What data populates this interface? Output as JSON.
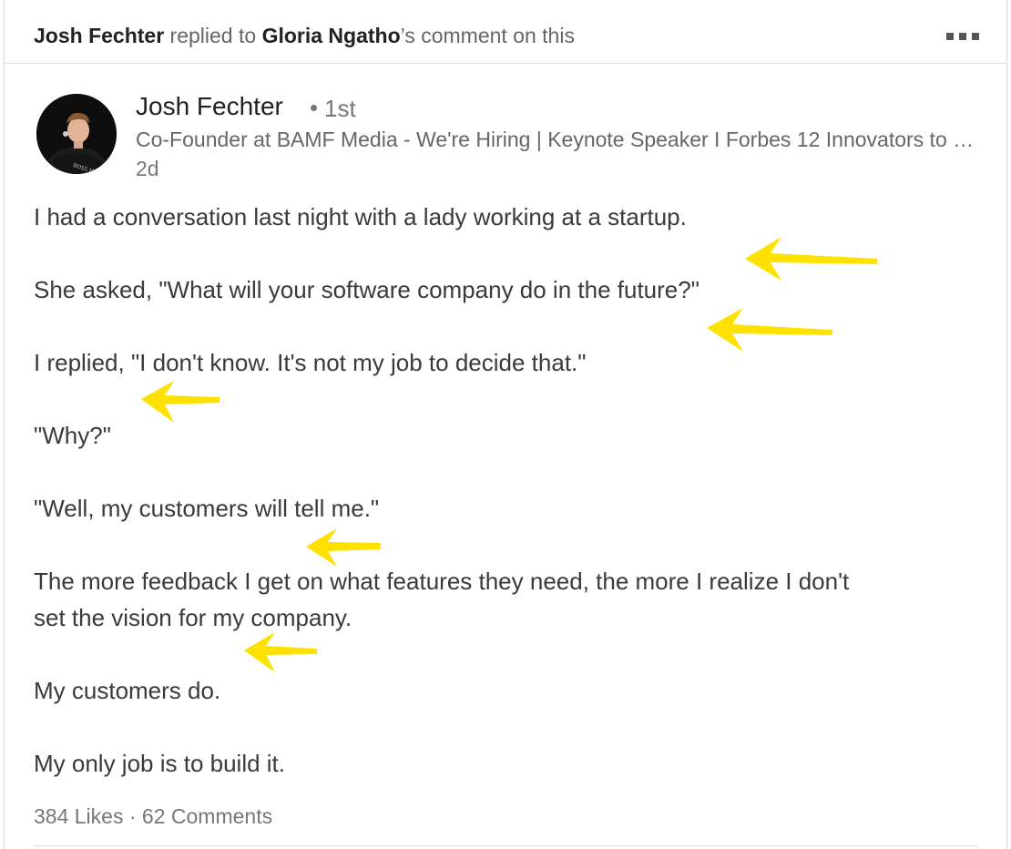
{
  "header": {
    "actor": "Josh Fechter",
    "action": " replied to ",
    "target": "Gloria Ngatho",
    "suffix": "’s comment on this"
  },
  "post": {
    "author_name": "Josh Fechter",
    "degree": "1st",
    "headline": "Co-Founder at BAMF Media - We're Hiring | Keynote Speaker I Forbes 12 Innovators to Watch",
    "time": "2d",
    "lines": [
      "I had a conversation last night with a lady working at a startup.",
      "She asked, \"What will your software company do in the future?\"",
      "I replied, \"I don't know. It's not my job to decide that.\"",
      "\"Why?\"",
      "\"Well, my customers will tell me.\"",
      "The more feedback I get on what features they need, the more I realize I don't",
      "set the vision for my company.",
      "My customers do.",
      "My only job is to build it."
    ],
    "likes": "384 Likes",
    "separator": " · ",
    "comments": "62 Comments"
  },
  "annotations": {
    "arrow_color": "#ffe100",
    "arrow_icon": "arrow-left-icon"
  }
}
